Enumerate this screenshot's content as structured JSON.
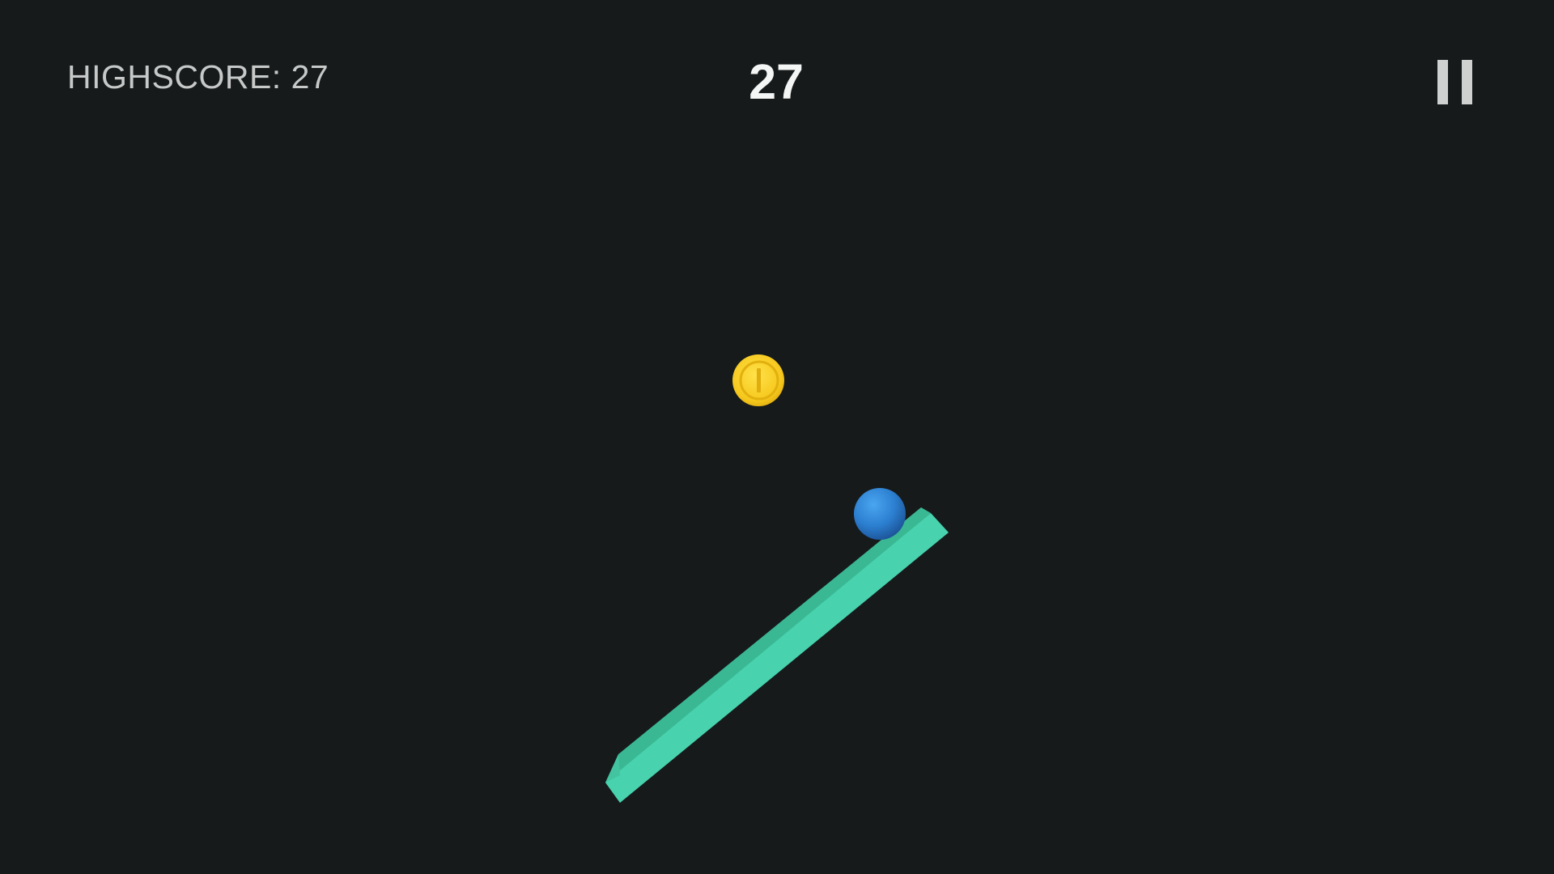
{
  "hud": {
    "highscore_label": "HIGHSCORE:",
    "highscore_value": "27",
    "score": "27"
  },
  "icons": {
    "pause": "pause-icon",
    "coin": "coin-icon",
    "ball": "ball",
    "platform": "platform"
  },
  "colors": {
    "background": "#161a1b",
    "platform_top": "#47d1ad",
    "platform_side": "#39b592",
    "ball": "#2f86d6",
    "coin": "#f5c518"
  }
}
